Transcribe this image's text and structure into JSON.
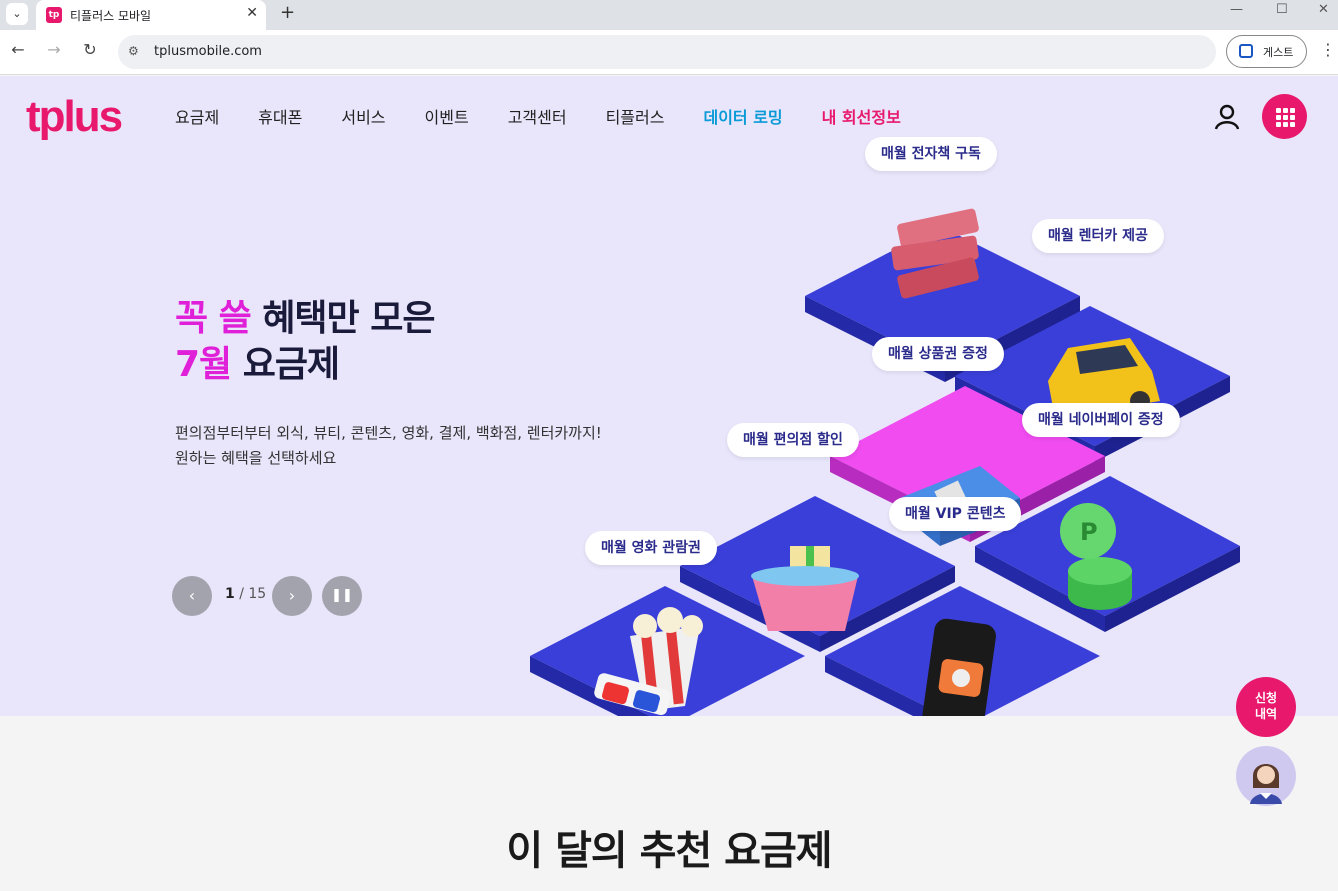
{
  "browser": {
    "tab_title": "티플러스 모바일",
    "tab_favicon": "tp",
    "url": "tplusmobile.com",
    "profile_label": "게스트"
  },
  "header": {
    "logo": "tplus",
    "nav": [
      {
        "label": "요금제",
        "style": "normal"
      },
      {
        "label": "휴대폰",
        "style": "normal"
      },
      {
        "label": "서비스",
        "style": "normal"
      },
      {
        "label": "이벤트",
        "style": "normal"
      },
      {
        "label": "고객센터",
        "style": "normal"
      },
      {
        "label": "티플러스",
        "style": "normal"
      },
      {
        "label": "데이터 로밍",
        "style": "blue"
      },
      {
        "label": "내 회선정보",
        "style": "pink"
      }
    ]
  },
  "hero": {
    "headline_line1_highlight": "꼭 쓸",
    "headline_line1_rest": " 혜택만 모은",
    "headline_line2_highlight": "7월",
    "headline_line2_rest": " 요금제",
    "desc_line1": "편의점부터부터 외식, 뷰티, 콘텐츠, 영화, 결제, 백화점, 렌터카까지!",
    "desc_line2": "원하는 혜택을 선택하세요",
    "slide_current": "1",
    "slide_total": "15",
    "benefits": [
      "매월 전자책 구독",
      "매월 렌터카 제공",
      "매월 상품권 증정",
      "매월 네이버페이 증정",
      "매월 편의점 할인",
      "매월 VIP 콘텐츠",
      "매월 영화 관람권"
    ]
  },
  "section": {
    "title": "이 달의 추천 요금제"
  },
  "floating": {
    "apply_label_line1": "신청",
    "apply_label_line2": "내역"
  },
  "colors": {
    "brand": "#e8196c",
    "tile_blue": "#3a3fd9",
    "tile_pink": "#f04cf0",
    "hero_bg": "#e9e6fb"
  }
}
